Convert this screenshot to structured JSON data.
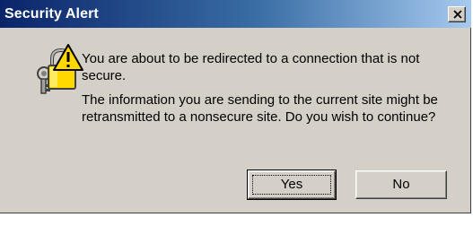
{
  "window": {
    "title": "Security Alert",
    "close_glyph": "✕",
    "icon": "security-lock-warning-icon"
  },
  "message": {
    "line1": "You are about to be redirected to a connection that is not secure.",
    "line2": "The information you are sending to the current site might be retransmitted to a nonsecure site. Do you wish to continue?"
  },
  "buttons": {
    "yes_label": "Yes",
    "no_label": "No"
  },
  "colors": {
    "titlebar_start": "#0a246a",
    "titlebar_end": "#a6caf0",
    "dialog_face": "#d4d0c8",
    "warning_yellow": "#ffd800"
  }
}
